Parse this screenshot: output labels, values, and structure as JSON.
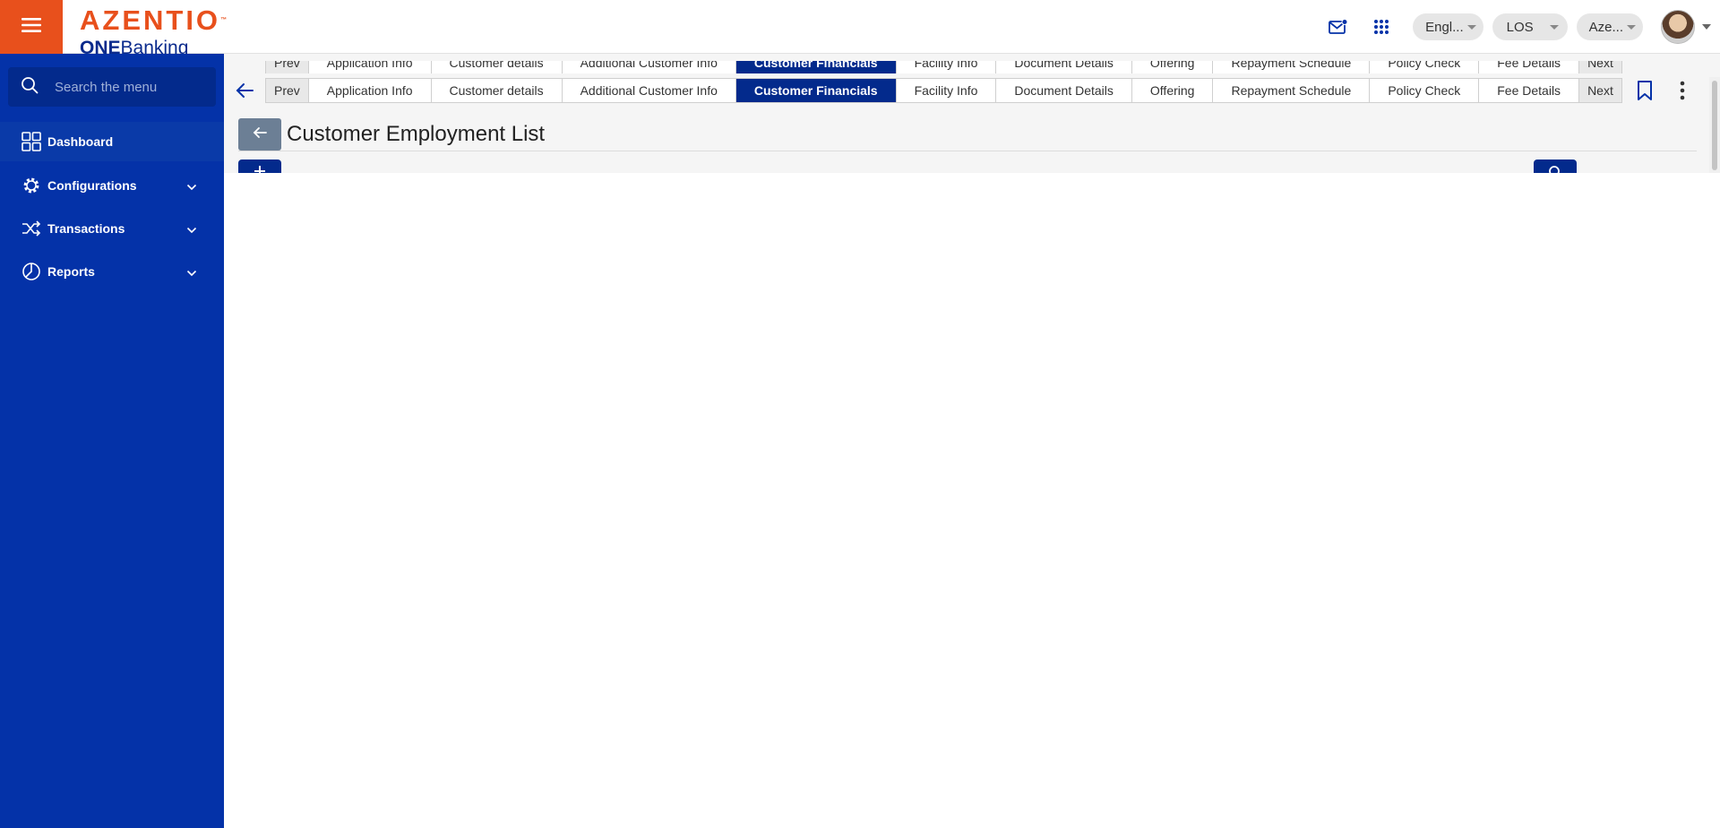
{
  "header": {
    "logo_text": "AZENTIO",
    "logo_tm": "™",
    "logo_sub_bold": "ONE",
    "logo_sub_rest": "Banking",
    "language": "Engl...",
    "module": "LOS",
    "user_short": "Aze...",
    "icons": [
      "hamburger-menu-icon",
      "mail-notification-icon",
      "apps-grid-icon",
      "avatar",
      "chevron-down-icon"
    ]
  },
  "sidebar": {
    "search_placeholder": "Search the menu",
    "items": [
      {
        "label": "Dashboard",
        "icon": "dashboard-grid-icon",
        "expandable": false
      },
      {
        "label": "Configurations",
        "icon": "gear-icon",
        "expandable": true
      },
      {
        "label": "Transactions",
        "icon": "shuffle-icon",
        "expandable": true
      },
      {
        "label": "Reports",
        "icon": "pie-chart-icon",
        "expandable": true
      }
    ]
  },
  "tabs": {
    "prev": "Prev",
    "next": "Next",
    "items": [
      "Application Info",
      "Customer details",
      "Additional Customer Info",
      "Customer Financials",
      "Facility Info",
      "Document Details",
      "Offering",
      "Repayment Schedule",
      "Policy Check",
      "Fee Details"
    ],
    "active": "Customer Financials"
  },
  "page": {
    "title": "Customer Employment List"
  },
  "colors": {
    "brand_orange": "#e8501c",
    "sidebar_blue": "#0432a8",
    "active_tab": "#032a8c",
    "back_button": "#6c7f95"
  }
}
